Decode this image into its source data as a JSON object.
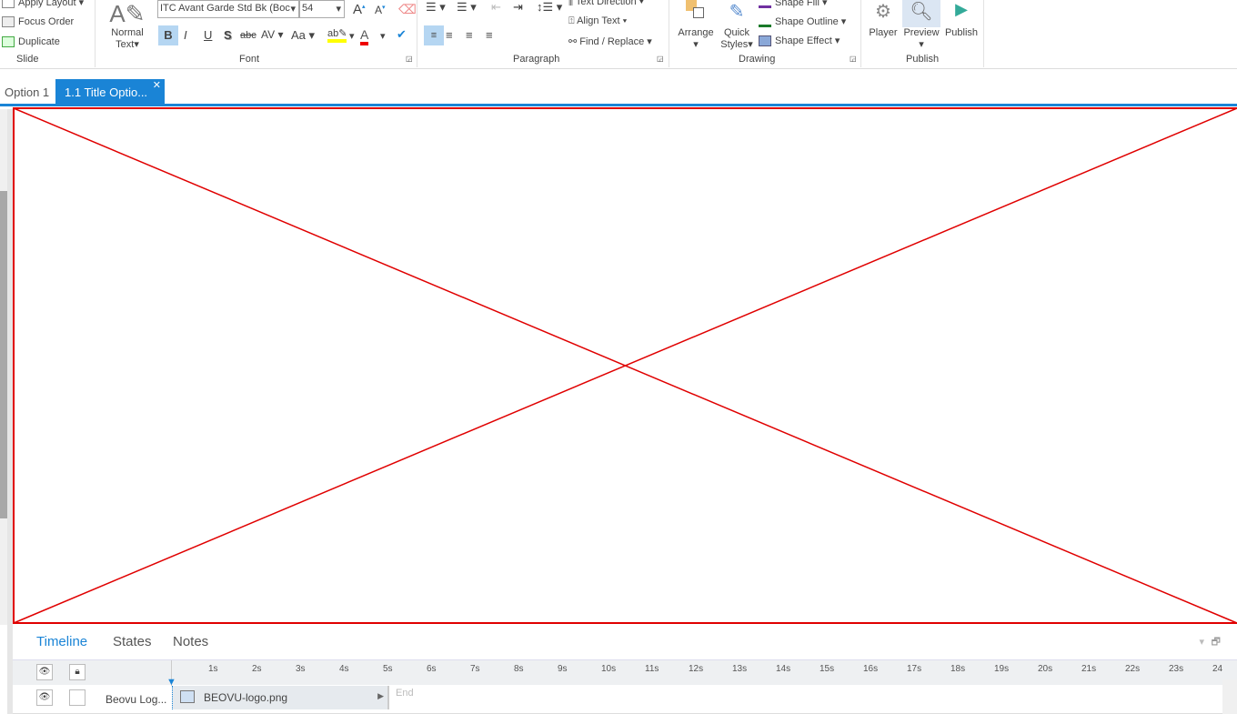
{
  "ribbon": {
    "slide": {
      "apply_layout": "Apply Layout",
      "focus_order": "Focus Order",
      "duplicate": "Duplicate",
      "label": "Slide"
    },
    "font": {
      "normal_text": "Normal",
      "normal_text2": "Text",
      "font_name": "ITC Avant Garde Std Bk (Boc",
      "font_size": "54",
      "bold": "B",
      "italic": "I",
      "underline": "U",
      "shadow": "S",
      "strike": "abc",
      "spacing": "AV",
      "case": "Aa",
      "label": "Font"
    },
    "paragraph": {
      "text_direction": "Text Direction",
      "align_text": "Align Text",
      "find_replace": "Find / Replace",
      "label": "Paragraph"
    },
    "drawing": {
      "arrange": "Arrange",
      "quick_styles": "Quick",
      "quick_styles2": "Styles",
      "shape_fill": "Shape Fill",
      "shape_outline": "Shape Outline",
      "shape_effect": "Shape Effect",
      "label": "Drawing"
    },
    "publish": {
      "player": "Player",
      "preview": "Preview",
      "publish": "Publish",
      "label": "Publish"
    }
  },
  "tabs": [
    {
      "label": "Option 1"
    },
    {
      "label": "1.1 Title Optio..."
    }
  ],
  "timeline": {
    "tabs": [
      "Timeline",
      "States",
      "Notes"
    ],
    "ticks": [
      "1s",
      "2s",
      "3s",
      "4s",
      "5s",
      "6s",
      "7s",
      "8s",
      "9s",
      "10s",
      "11s",
      "12s",
      "13s",
      "14s",
      "15s",
      "16s",
      "17s",
      "18s",
      "19s",
      "20s",
      "21s",
      "22s",
      "23s",
      "24"
    ],
    "row": {
      "name": "Beovu Log...",
      "object": "BEOVU-logo.png",
      "end": "End"
    }
  },
  "colors": {
    "accent": "#1a84d6",
    "placeholder_red": "#e00000"
  }
}
